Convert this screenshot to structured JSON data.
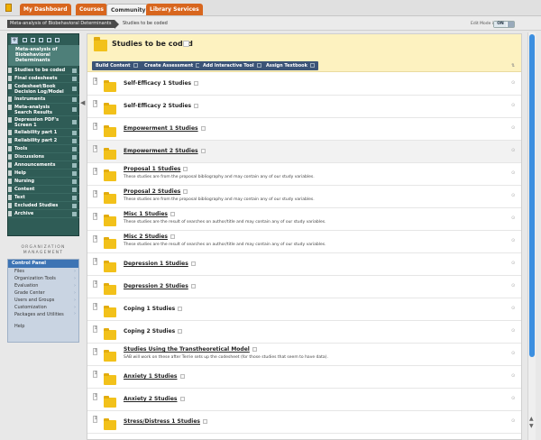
{
  "tabs": [
    "My Dashboard",
    "Courses",
    "Community",
    "Library Services"
  ],
  "breadcrumb": {
    "course": "Meta-analysis of Biobehavioral Determinants",
    "current": "Studies to be coded"
  },
  "edit_mode": {
    "label": "Edit Mode is:",
    "value": "ON"
  },
  "sidebar": {
    "course_name": "Meta-analysis of Biobehavioral Determinants",
    "items": [
      "Studies to be coded",
      "Final codesheets",
      "Codesheet/Book Decision Log/Model",
      "Instruments",
      "Meta-analysis Search Results",
      "Depression PDF's Screen 1",
      "Reliability part 1",
      "Reliability part 2",
      "Tools",
      "Discussions",
      "Announcements",
      "Help",
      "Nursing",
      "Content",
      "Text",
      "Excluded Studies",
      "Archive"
    ]
  },
  "org_label": "ORGANIZATION MANAGEMENT",
  "control_panel": {
    "title": "Control Panel",
    "items": [
      "Files",
      "Organization Tools",
      "Evaluation",
      "Grade Center",
      "Users and Groups",
      "Customization",
      "Packages and Utilities",
      "Help"
    ]
  },
  "page": {
    "title": "Studies to be coded"
  },
  "actions": [
    "Build Content",
    "Create Assessment",
    "Add Interactive Tool",
    "Assign Textbook"
  ],
  "items": [
    {
      "title": "Self-Efficacy 1 Studies",
      "desc": ""
    },
    {
      "title": "Self-Efficacy 2 Studies",
      "desc": ""
    },
    {
      "title": "Empowerment 1 Studies",
      "desc": ""
    },
    {
      "title": "Empowerment 2 Studies",
      "desc": ""
    },
    {
      "title": "Proposal 1 Studies",
      "desc": "These studies are from the proposal bibliography and may contain any of our study variables."
    },
    {
      "title": "Proposal 2 Studies",
      "desc": "These studies are from the proposal bibliography and may contain any of our study variables."
    },
    {
      "title": "Misc 1 Studies",
      "desc": "These studies are the result of searches on author/title and may contain any of our study variables."
    },
    {
      "title": "Misc 2 Studies",
      "desc": "These studies are the result of searches on author/title and may contain any of our study variables."
    },
    {
      "title": "Depression 1 Studies",
      "desc": ""
    },
    {
      "title": "Depression 2 Studies",
      "desc": ""
    },
    {
      "title": "Coping 1 Studies",
      "desc": ""
    },
    {
      "title": "Coping 2 Studies",
      "desc": ""
    },
    {
      "title": "Studies Using the Transtheoretical Model",
      "desc": "SAB will work on these after Terrie sets up the codesheet (for those studies that seem to have data)."
    },
    {
      "title": "Anxiety 1 Studies",
      "desc": ""
    },
    {
      "title": "Anxiety 2 Studies",
      "desc": ""
    },
    {
      "title": "Stress/Distress 1 Studies",
      "desc": ""
    }
  ]
}
